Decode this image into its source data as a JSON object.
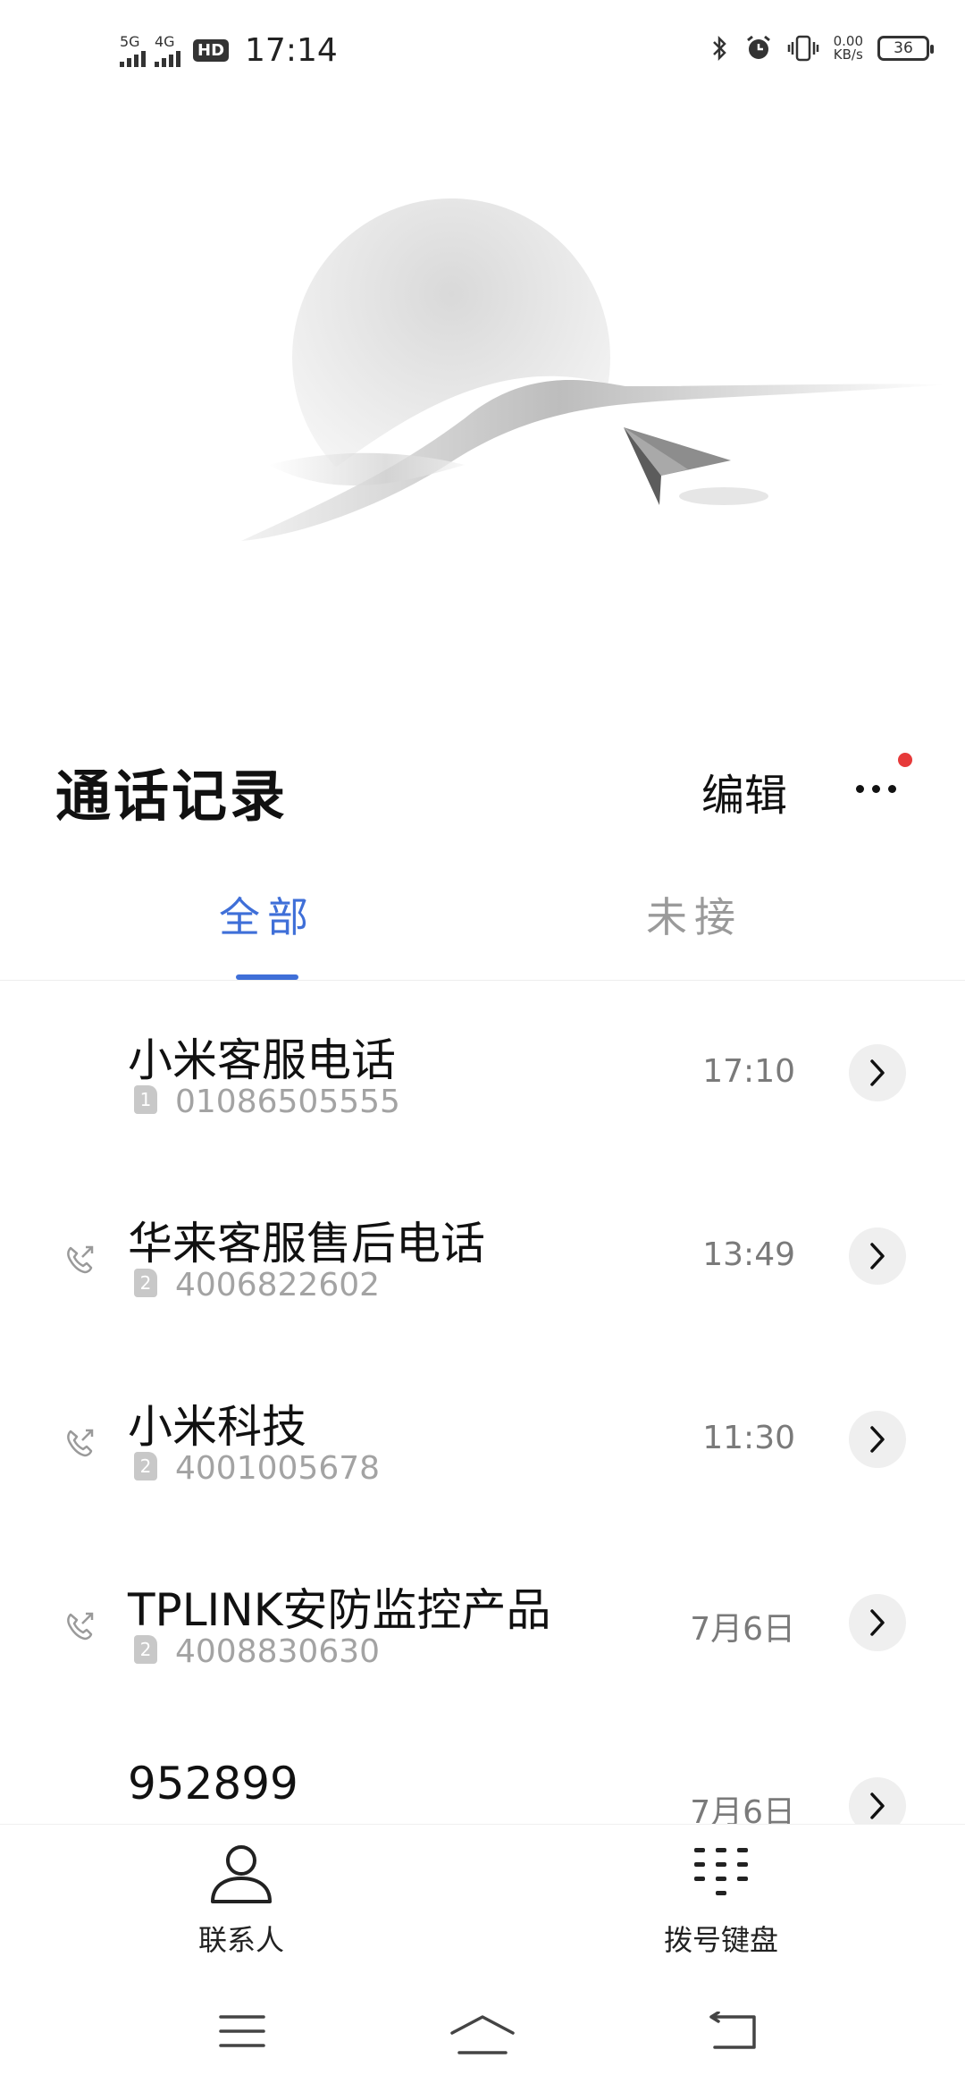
{
  "status_bar": {
    "sim1_network": "5G",
    "sim2_network": "4G",
    "hd_label": "HD",
    "time": "17:14",
    "net_speed_value": "0.00",
    "net_speed_unit": "KB/s",
    "battery_level": "36"
  },
  "header": {
    "title": "通话记录",
    "edit_label": "编辑"
  },
  "tabs": [
    {
      "label": "全部",
      "active": true
    },
    {
      "label": "未接",
      "active": false
    }
  ],
  "calls": [
    {
      "name": "小米客服电话",
      "sim": "1",
      "number": "01086505555",
      "time": "17:10",
      "show_call_icon": false
    },
    {
      "name": "华来客服售后电话",
      "sim": "2",
      "number": "4006822602",
      "time": "13:49",
      "show_call_icon": true
    },
    {
      "name": "小米科技",
      "sim": "2",
      "number": "4001005678",
      "time": "11:30",
      "show_call_icon": true
    },
    {
      "name": "TPLINK安防监控产品",
      "sim": "2",
      "number": "4008830630",
      "time": "7月6日",
      "show_call_icon": true
    },
    {
      "name": "952899",
      "sim": "",
      "number": "",
      "time": "7月6日",
      "show_call_icon": false
    }
  ],
  "bottom_nav": {
    "contacts_label": "联系人",
    "dialpad_label": "拨号键盘"
  },
  "colors": {
    "accent": "#3f6fd8",
    "badge": "#e63a3a"
  }
}
